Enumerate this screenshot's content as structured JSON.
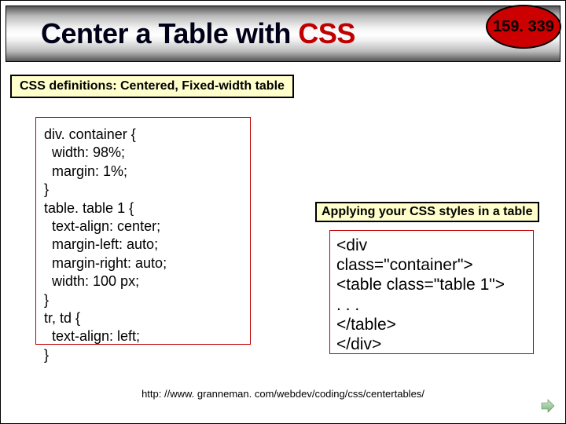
{
  "header": {
    "title_prefix": "Center a Table with ",
    "title_suffix": "CSS",
    "badge": "159. 339"
  },
  "left_caption": "CSS definitions:  Centered, Fixed-width table",
  "code_left": "div. container {\n  width: 98%;\n  margin: 1%;\n}\ntable. table 1 {\n  text-align: center;\n  margin-left: auto;\n  margin-right: auto;\n  width: 100 px;\n}\ntr, td {\n  text-align: left;\n}",
  "right_caption": "Applying your CSS styles in a table",
  "code_right": "<div\nclass=\"container\">\n<table class=\"table 1\">\n. . .\n</table>\n</div>",
  "footer_url": "http: //www. granneman. com/webdev/coding/css/centertables/"
}
